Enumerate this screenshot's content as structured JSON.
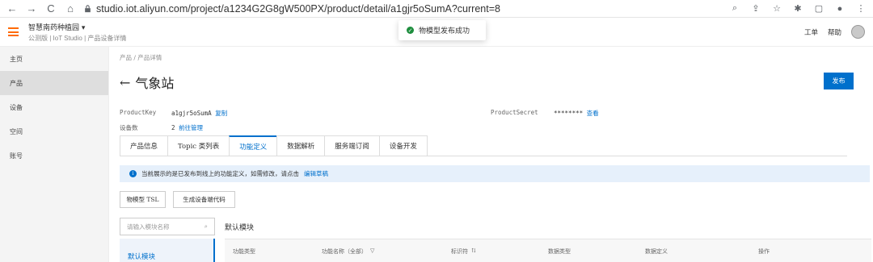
{
  "browser": {
    "url": "studio.iot.aliyun.com/project/a1234G2G8gW500PX/product/detail/a1gjr5oSumA?current=8",
    "back": "←",
    "forward": "→",
    "reload": "C",
    "home": "⌂"
  },
  "header": {
    "brand_line1": "智慧南药种植园 ▾",
    "brand_line2": "公测版 | IoT Studio | 产品设备详情",
    "work_order": "工单",
    "help": "帮助",
    "toast": "物模型发布成功"
  },
  "sidebar": {
    "items": [
      {
        "label": "主页"
      },
      {
        "label": "产品"
      },
      {
        "label": "设备"
      },
      {
        "label": "空间"
      },
      {
        "label": "账号"
      }
    ]
  },
  "main": {
    "breadcrumb": "产品 / 产品详情",
    "title": "气象站",
    "publish_label": "发布",
    "product_key_label": "ProductKey",
    "product_key_value": "a1gjr5oSumA",
    "copy_label": "复制",
    "product_secret_label": "ProductSecret",
    "product_secret_value": "********",
    "view_label": "查看",
    "device_count_label": "设备数",
    "device_count_value": "2",
    "manage_label": "前往管理",
    "tabs": [
      {
        "label": "产品信息"
      },
      {
        "label": "Topic 类列表"
      },
      {
        "label": "功能定义"
      },
      {
        "label": "数据解析"
      },
      {
        "label": "服务端订阅"
      },
      {
        "label": "设备开发"
      }
    ],
    "info_text": "当前展示的是已发布到线上的功能定义，如需修改，请点击",
    "info_link": "编辑草稿",
    "tsl_button": "物模型 TSL",
    "gen_code_button": "生成设备端代码",
    "module_search_placeholder": "请输入模块名称",
    "module_title": "默认模块",
    "module_item": "默认模块",
    "table_headers": [
      {
        "label": "功能类型"
      },
      {
        "label": "功能名称（全部）"
      },
      {
        "label": "标识符"
      },
      {
        "label": "数据类型"
      },
      {
        "label": "数据定义"
      },
      {
        "label": "操作"
      }
    ]
  }
}
